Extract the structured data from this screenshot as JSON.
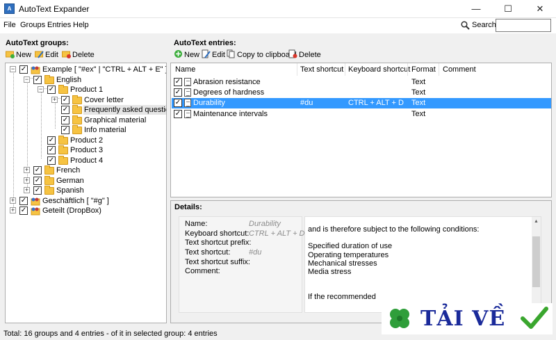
{
  "window": {
    "title": "AutoText Expander",
    "app_icon_label": "A",
    "controls": {
      "minimize": "—",
      "maximize": "☐",
      "close": "✕"
    }
  },
  "menu": [
    "File",
    "Groups",
    "Entries",
    "Help"
  ],
  "search": {
    "label": "Search:",
    "value": ""
  },
  "groups_panel": {
    "title": "AutoText groups:",
    "toolbar": {
      "new": "New",
      "edit": "Edit",
      "delete": "Delete"
    },
    "tree": [
      {
        "label": "Example [ \"#ex\" | \"CTRL + ALT + E\" ]",
        "expander": "−",
        "checked": true
      },
      {
        "label": "English",
        "expander": "−",
        "checked": true
      },
      {
        "label": "Product 1",
        "expander": "−",
        "checked": true
      },
      {
        "label": "Cover letter",
        "expander": "+",
        "checked": true
      },
      {
        "label": "Frequently asked questions",
        "expander": "",
        "checked": true
      },
      {
        "label": "Graphical material",
        "expander": "",
        "checked": true
      },
      {
        "label": "Info material",
        "expander": "",
        "checked": true
      },
      {
        "label": "Product 2",
        "expander": "",
        "checked": true
      },
      {
        "label": "Product 3",
        "expander": "",
        "checked": true
      },
      {
        "label": "Product 4",
        "expander": "",
        "checked": true
      },
      {
        "label": "French",
        "expander": "+",
        "checked": true
      },
      {
        "label": "German",
        "expander": "+",
        "checked": true
      },
      {
        "label": "Spanish",
        "expander": "+",
        "checked": true
      },
      {
        "label": "Geschäftlich [ \"#g\" ]",
        "expander": "+",
        "checked": true
      },
      {
        "label": "Geteilt (DropBox)",
        "expander": "+",
        "checked": true
      }
    ]
  },
  "entries_panel": {
    "title": "AutoText entries:",
    "toolbar": {
      "new": "New",
      "edit": "Edit",
      "copy": "Copy to clipboard",
      "delete": "Delete"
    },
    "columns": [
      "Name",
      "Text shortcut",
      "Keyboard shortcut",
      "Format",
      "Comment"
    ],
    "rows": [
      {
        "name": "Abrasion resistance",
        "text_shortcut": "",
        "keyboard_shortcut": "",
        "format": "Text",
        "comment": "",
        "selected": false
      },
      {
        "name": "Degrees of hardness",
        "text_shortcut": "",
        "keyboard_shortcut": "",
        "format": "Text",
        "comment": "",
        "selected": false
      },
      {
        "name": "Durability",
        "text_shortcut": "#du",
        "keyboard_shortcut": "CTRL + ALT + D",
        "format": "Text",
        "comment": "",
        "selected": true
      },
      {
        "name": "Maintenance intervals",
        "text_shortcut": "",
        "keyboard_shortcut": "",
        "format": "Text",
        "comment": "",
        "selected": false
      }
    ]
  },
  "details": {
    "title": "Details:",
    "fields": [
      {
        "key": "Name:",
        "value": "Durability"
      },
      {
        "key": "Keyboard shortcut:",
        "value": "CTRL + ALT + D"
      },
      {
        "key": "Text shortcut prefix:",
        "value": ""
      },
      {
        "key": "Text shortcut:",
        "value": "#du"
      },
      {
        "key": "Text shortcut suffix:",
        "value": ""
      },
      {
        "key": "Comment:",
        "value": ""
      }
    ],
    "content_lines": [
      "and is therefore subject to the following conditions:",
      "",
      "Specified duration of use",
      "Operating temperatures",
      "Mechanical stresses",
      "Media stress",
      "",
      "",
      "If the recommended"
    ]
  },
  "status": "Total: 16 groups and 4 entries - of it in selected group: 4 entries",
  "watermark": {
    "text": "TẢI VỀ"
  },
  "colors": {
    "selection": "#3399ff",
    "folder": "#f6c342",
    "window_bg": "#f0f0f0"
  }
}
